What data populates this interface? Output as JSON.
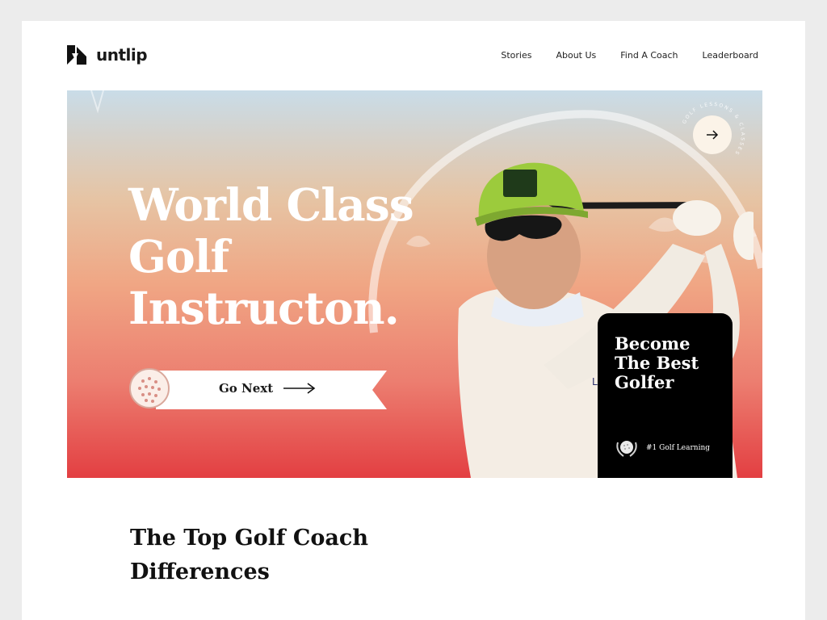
{
  "brand": {
    "name": "untlip"
  },
  "nav": {
    "items": [
      "Stories",
      "About Us",
      "Find A Coach",
      "Leaderboard"
    ]
  },
  "hero": {
    "title": "World Class Golf Instructon.",
    "cta_label": "Go Next",
    "round_button_icon": "arrow-right-icon",
    "ring_text": "GOLF LESSONS & CLASSES",
    "colors": {
      "top": "#c9dce8",
      "middle": "#f0a684",
      "bottom": "#e33f42"
    }
  },
  "card": {
    "title": "Become The Best Golfer",
    "badge_label": "#1 Golf Learning",
    "badge_icon": "laurel-golf-ball-icon"
  },
  "section": {
    "title": "The Top Golf Coach Differences"
  }
}
